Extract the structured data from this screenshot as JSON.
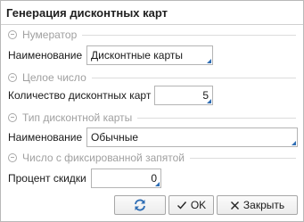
{
  "window": {
    "title": "Генерация дисконтных карт"
  },
  "groups": {
    "numerator": "Нумератор",
    "integer": "Целое число",
    "card_type": "Тип дисконтной карты",
    "fixed_point": "Число с фиксированной запятой"
  },
  "fields": {
    "numerator_name": {
      "label": "Наименование",
      "value": "Дисконтные карты"
    },
    "card_count": {
      "label": "Количество дисконтных карт",
      "value": "5"
    },
    "card_type_name": {
      "label": "Наименование",
      "value": "Обычные"
    },
    "discount_percent": {
      "label": "Процент скидки",
      "value": "0"
    }
  },
  "buttons": {
    "refresh_icon": "refresh-icon",
    "ok": "OK",
    "close": "Закрыть"
  },
  "colors": {
    "accent": "#2e6db4",
    "muted_text": "#a0a0a0"
  }
}
